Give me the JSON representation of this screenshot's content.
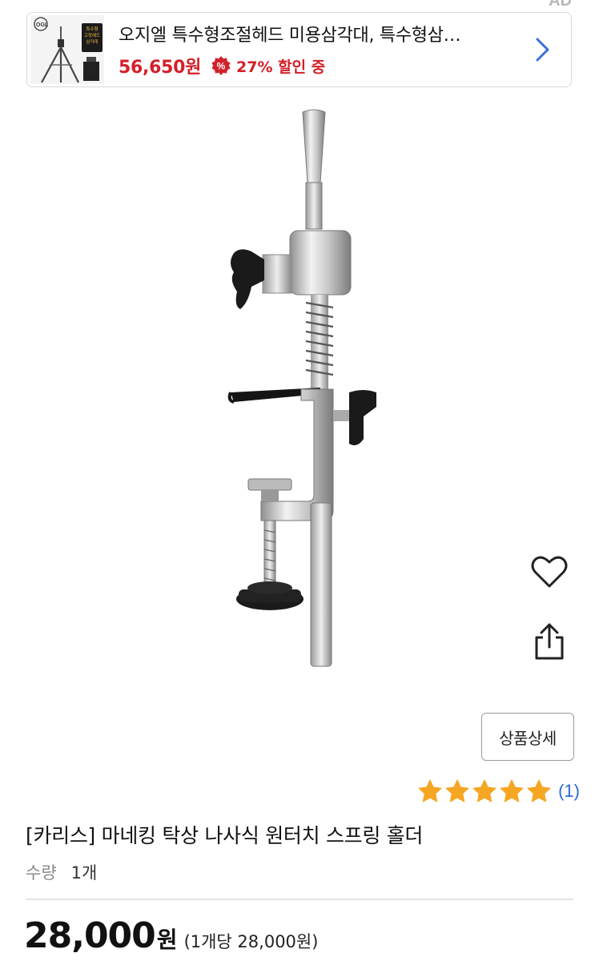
{
  "ad": {
    "label": "AD",
    "title": "오지엘 특수형조절헤드 미용삼각대, 특수형삼…",
    "price": "56,650원",
    "discount": "27% 할인 중",
    "discount_icon": "percent-badge-icon",
    "arrow_icon": "chevron-right-icon",
    "thumb": {
      "brand": "OGL",
      "badge_lines": [
        "특수형",
        "고정헤드",
        "삼각대"
      ]
    }
  },
  "side_actions": {
    "favorite_icon": "heart-outline-icon",
    "share_icon": "share-icon"
  },
  "detail_button_label": "상품상세",
  "rating": {
    "stars": 5,
    "count": "(1)",
    "color": "#f5a623"
  },
  "product": {
    "title": "[카리스] 마네킹 탁상 나사식 원터치 스프링 홀더",
    "quantity_label": "수량",
    "quantity_value": "1개",
    "price": "28,000",
    "price_unit": "원",
    "price_note": "(1개당 28,000원)"
  },
  "colors": {
    "ad_price": "#d3202a",
    "link_blue": "#2a6ad6",
    "star": "#f5a623"
  }
}
